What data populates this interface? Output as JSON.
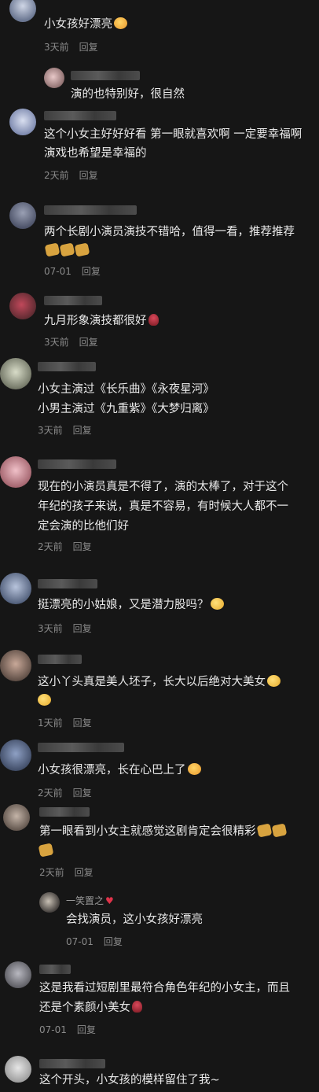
{
  "comments": [
    {
      "text_lines": [
        "小女孩好漂亮"
      ],
      "emoji": [
        "love-eyes"
      ],
      "time": "3天前",
      "reply": "回复"
    },
    {
      "text_lines": [
        "演的也特别好，很自然"
      ],
      "time": "",
      "reply": ""
    },
    {
      "text_lines": [
        "这个小女主好好好看 第一眼就喜欢啊 一定要幸福啊",
        "演戏也希望是幸福的"
      ],
      "time": "2天前",
      "reply": "回复"
    },
    {
      "text_lines": [
        "两个长剧小演员演技不错哈，值得一看，推荐推荐"
      ],
      "emoji": [
        "heart-gift",
        "heart-gift",
        "heart-gift"
      ],
      "time": "07-01",
      "reply": "回复"
    },
    {
      "text_lines": [
        "九月形象演技都很好"
      ],
      "emoji": [
        "rose"
      ],
      "time": "3天前",
      "reply": "回复"
    },
    {
      "text_lines": [
        "小女主演过《长乐曲》《永夜星河》",
        "小男主演过《九重紫》《大梦归离》"
      ],
      "time": "3天前",
      "reply": "回复"
    },
    {
      "text_lines": [
        "现在的小演员真是不得了，演的太棒了，对于这个",
        "年纪的孩子来说，真是不容易，有时候大人都不一",
        "定会演的比他们好"
      ],
      "time": "2天前",
      "reply": "回复"
    },
    {
      "text_lines": [
        "挺漂亮的小姑娘，又是潜力股吗？"
      ],
      "emoji": [
        "laugh-cry"
      ],
      "time": "3天前",
      "reply": "回复"
    },
    {
      "text_lines": [
        "这小丫头真是美人坯子，长大以后绝对大美女"
      ],
      "emoji": [
        "smirk",
        "smirk"
      ],
      "time": "1天前",
      "reply": "回复"
    },
    {
      "text_lines": [
        "小女孩很漂亮，长在心巴上了"
      ],
      "emoji": [
        "hearts-face"
      ],
      "time": "2天前",
      "reply": "回复"
    },
    {
      "text_lines": [
        "第一眼看到小女主就感觉这剧肯定会很精彩"
      ],
      "emoji": [
        "heart-gift",
        "heart-gift",
        "heart-gift"
      ],
      "time": "2天前",
      "reply": "回复"
    },
    {
      "author": "一笑置之",
      "text_lines": [
        "会找演员，这小女孩好漂亮"
      ],
      "time": "07-01",
      "reply": "回复"
    },
    {
      "text_lines": [
        "这是我看过短剧里最符合角色年纪的小女主，而且",
        "还是个素颜小美女"
      ],
      "emoji": [
        "rose"
      ],
      "time": "07-01",
      "reply": "回复"
    },
    {
      "text_lines": [
        "这个开头，小女孩的模样留住了我~"
      ],
      "time": "",
      "reply": ""
    }
  ],
  "colors": {
    "background": "#161616",
    "text": "#eaeaea",
    "meta": "#8a8a8a"
  }
}
